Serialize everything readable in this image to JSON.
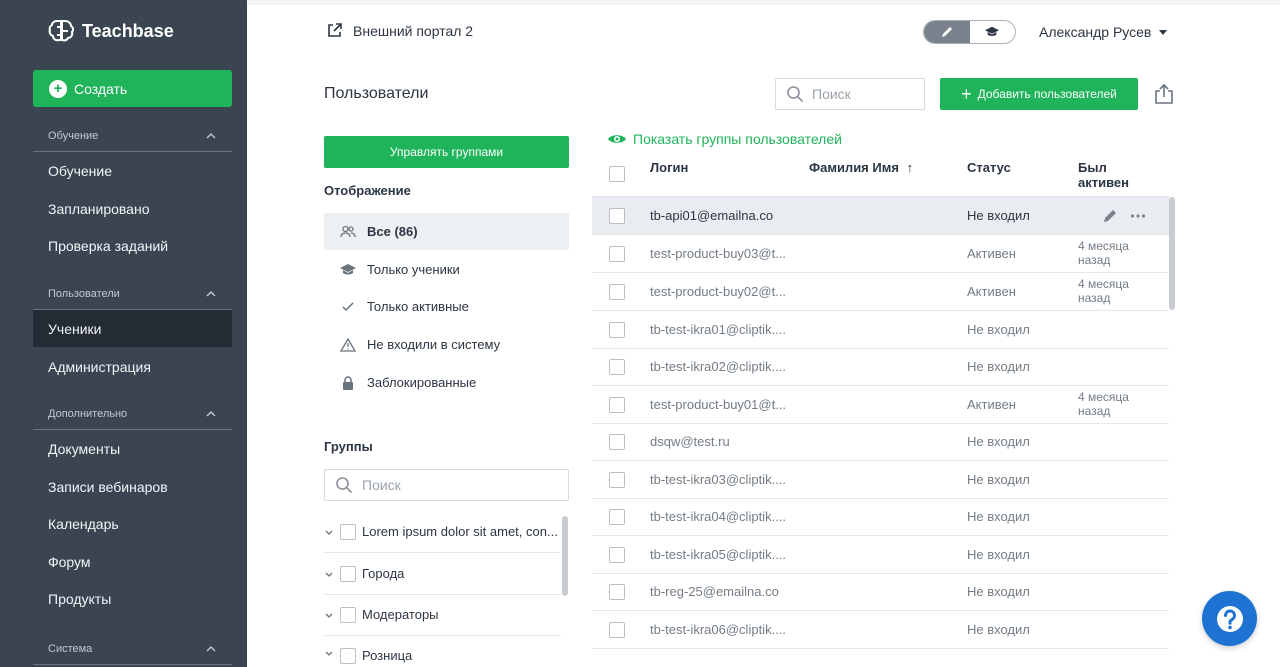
{
  "app": {
    "brand": "Teachbase",
    "portal": "Внешний портал 2",
    "user": "Александр Русев"
  },
  "sidebar": {
    "create_label": "Создать",
    "sections": [
      {
        "label": "Обучение",
        "items": [
          "Обучение",
          "Запланировано",
          "Проверка заданий"
        ]
      },
      {
        "label": "Пользователи",
        "items": [
          "Ученики",
          "Администрация"
        ]
      },
      {
        "label": "Дополнительно",
        "items": [
          "Документы",
          "Записи вебинаров",
          "Календарь",
          "Форум",
          "Продукты"
        ]
      },
      {
        "label": "Система",
        "items": []
      }
    ],
    "active_item": "Ученики"
  },
  "page": {
    "title": "Пользователи",
    "search_placeholder": "Поиск",
    "add_users_label": "Добавить пользователей",
    "manage_groups_label": "Управлять группами",
    "display_title": "Отображение",
    "filters": [
      {
        "label": "Все (86)",
        "icon": "users-icon",
        "selected": true
      },
      {
        "label": "Только ученики",
        "icon": "graduation-cap-icon",
        "selected": false
      },
      {
        "label": "Только активные",
        "icon": "check-icon",
        "selected": false
      },
      {
        "label": "Не входили в систему",
        "icon": "warning-icon",
        "selected": false
      },
      {
        "label": "Заблокированные",
        "icon": "lock-icon",
        "selected": false
      }
    ],
    "groups_title": "Группы",
    "groups_search_placeholder": "Поиск",
    "groups": [
      "Lorem ipsum dolor sit amet, con...",
      "Города",
      "Модераторы",
      "Розница"
    ],
    "show_groups_label": "Показать группы пользователей"
  },
  "table": {
    "columns": {
      "login": "Логин",
      "name": "Фамилия Имя",
      "sort_arrow": "↑",
      "status": "Статус",
      "last_active": "Был активен"
    },
    "rows": [
      {
        "login": "tb-api01@emailna.co",
        "status": "Не входил",
        "last_active": ""
      },
      {
        "login": "test-product-buy03@t...",
        "status": "Активен",
        "last_active": "4 месяца назад"
      },
      {
        "login": "test-product-buy02@t...",
        "status": "Активен",
        "last_active": "4 месяца назад"
      },
      {
        "login": "tb-test-ikra01@cliptik....",
        "status": "Не входил",
        "last_active": ""
      },
      {
        "login": "tb-test-ikra02@cliptik....",
        "status": "Не входил",
        "last_active": ""
      },
      {
        "login": "test-product-buy01@t...",
        "status": "Активен",
        "last_active": "4 месяца назад"
      },
      {
        "login": "dsqw@test.ru",
        "status": "Не входил",
        "last_active": ""
      },
      {
        "login": "tb-test-ikra03@cliptik....",
        "status": "Не входил",
        "last_active": ""
      },
      {
        "login": "tb-test-ikra04@cliptik....",
        "status": "Не входил",
        "last_active": ""
      },
      {
        "login": "tb-test-ikra05@cliptik....",
        "status": "Не входил",
        "last_active": ""
      },
      {
        "login": "tb-reg-25@emailna.co",
        "status": "Не входил",
        "last_active": ""
      },
      {
        "login": "tb-test-ikra06@cliptik....",
        "status": "Не входил",
        "last_active": ""
      }
    ]
  },
  "colors": {
    "sidebar_bg": "#3b4552",
    "accent_green": "#1fb45a",
    "help_blue": "#1e73d2"
  }
}
